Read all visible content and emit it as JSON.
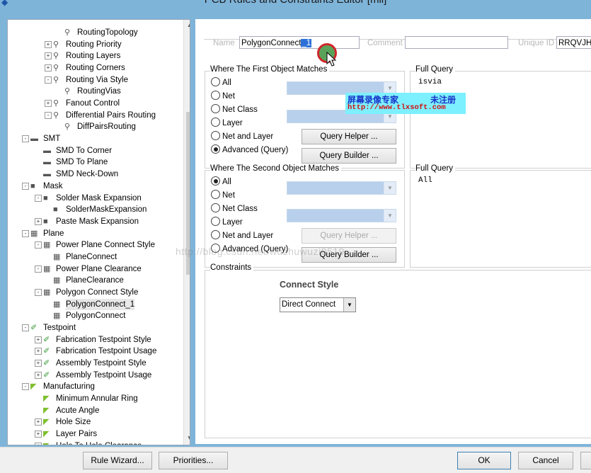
{
  "window": {
    "title": "PCB Rules and Constraints Editor [mil]"
  },
  "tree": {
    "items": [
      {
        "label": "RoutingTopology",
        "icon": "rule-icon",
        "expander": ""
      },
      {
        "label": "Routing Priority",
        "icon": "rule-type-icon",
        "expander": "+"
      },
      {
        "label": "Routing Layers",
        "icon": "rule-type-icon",
        "expander": "+"
      },
      {
        "label": "Routing Corners",
        "icon": "rule-type-icon",
        "expander": "+"
      },
      {
        "label": "Routing Via Style",
        "icon": "rule-type-icon",
        "expander": "-"
      },
      {
        "label": "RoutingVias",
        "icon": "rule-icon",
        "expander": ""
      },
      {
        "label": "Fanout Control",
        "icon": "rule-type-icon",
        "expander": "+"
      },
      {
        "label": "Differential Pairs Routing",
        "icon": "rule-type-icon",
        "expander": "-"
      },
      {
        "label": "DiffPairsRouting",
        "icon": "rule-icon",
        "expander": ""
      },
      {
        "label": "SMT",
        "icon": "smt-category-icon",
        "expander": "-"
      },
      {
        "label": "SMD To Corner",
        "icon": "smt-rule-icon",
        "expander": ""
      },
      {
        "label": "SMD To Plane",
        "icon": "smt-rule-icon",
        "expander": ""
      },
      {
        "label": "SMD Neck-Down",
        "icon": "smt-rule-icon",
        "expander": ""
      },
      {
        "label": "Mask",
        "icon": "mask-category-icon",
        "expander": "-"
      },
      {
        "label": "Solder Mask Expansion",
        "icon": "mask-rule-icon",
        "expander": "-"
      },
      {
        "label": "SolderMaskExpansion",
        "icon": "mask-rule-icon",
        "expander": ""
      },
      {
        "label": "Paste Mask Expansion",
        "icon": "mask-rule-icon",
        "expander": "+"
      },
      {
        "label": "Plane",
        "icon": "plane-category-icon",
        "expander": "-"
      },
      {
        "label": "Power Plane Connect Style",
        "icon": "plane-rule-icon",
        "expander": "-"
      },
      {
        "label": "PlaneConnect",
        "icon": "plane-rule-icon",
        "expander": ""
      },
      {
        "label": "Power Plane Clearance",
        "icon": "plane-rule-icon",
        "expander": "-"
      },
      {
        "label": "PlaneClearance",
        "icon": "plane-rule-icon",
        "expander": ""
      },
      {
        "label": "Polygon Connect Style",
        "icon": "plane-rule-icon",
        "expander": "-"
      },
      {
        "label": "PolygonConnect_1",
        "icon": "plane-rule-icon",
        "expander": ""
      },
      {
        "label": "PolygonConnect",
        "icon": "plane-rule-icon",
        "expander": ""
      },
      {
        "label": "Testpoint",
        "icon": "testpoint-category-icon",
        "expander": "-"
      },
      {
        "label": "Fabrication Testpoint Style",
        "icon": "testpoint-rule-icon",
        "expander": "+"
      },
      {
        "label": "Fabrication Testpoint Usage",
        "icon": "testpoint-rule-icon",
        "expander": "+"
      },
      {
        "label": "Assembly Testpoint Style",
        "icon": "testpoint-rule-icon",
        "expander": "+"
      },
      {
        "label": "Assembly Testpoint Usage",
        "icon": "testpoint-rule-icon",
        "expander": "+"
      },
      {
        "label": "Manufacturing",
        "icon": "manufacturing-category-icon",
        "expander": "-"
      },
      {
        "label": "Minimum Annular Ring",
        "icon": "manufacturing-rule-icon",
        "expander": ""
      },
      {
        "label": "Acute Angle",
        "icon": "manufacturing-rule-icon",
        "expander": ""
      },
      {
        "label": "Hole Size",
        "icon": "manufacturing-rule-icon",
        "expander": "+"
      },
      {
        "label": "Layer Pairs",
        "icon": "manufacturing-rule-icon",
        "expander": "+"
      },
      {
        "label": "Hole To Hole Clearance",
        "icon": "manufacturing-rule-icon",
        "expander": "+"
      }
    ],
    "selected": "PolygonConnect_1"
  },
  "header": {
    "name_label": "Name",
    "name_value": "PolygonConnect",
    "name_selected": "_1",
    "comment_label": "Comment",
    "comment_value": "",
    "uid_label": "Unique ID",
    "uid_value": "RRQVJHT"
  },
  "first": {
    "title": "Where The First Object Matches",
    "options": [
      "All",
      "Net",
      "Net Class",
      "Layer",
      "Net and Layer",
      "Advanced (Query)"
    ],
    "selected": "Advanced (Query)",
    "query_helper": "Query Helper ...",
    "query_builder": "Query Builder ...",
    "full_query_title": "Full Query",
    "full_query": "isvia"
  },
  "second": {
    "title": "Where The Second Object Matches",
    "options": [
      "All",
      "Net",
      "Net Class",
      "Layer",
      "Net and Layer",
      "Advanced (Query)"
    ],
    "selected": "All",
    "query_helper": "Query Helper ...",
    "query_builder": "Query Builder ...",
    "full_query_title": "Full Query",
    "full_query": "All"
  },
  "constraints": {
    "title": "Constraints",
    "connect_style_label": "Connect Style",
    "connect_style_value": "Direct Connect"
  },
  "watermark": {
    "cn_left": "屏幕录像专家",
    "cn_right": "未注册",
    "url": "http://www.tlxsoft.com",
    "blog": "http://blog.csdn.net/wuzhuwuzi0519"
  },
  "buttons": {
    "rule_wizard": "Rule Wizard...",
    "priorities": "Priorities...",
    "ok": "OK",
    "cancel": "Cancel"
  }
}
